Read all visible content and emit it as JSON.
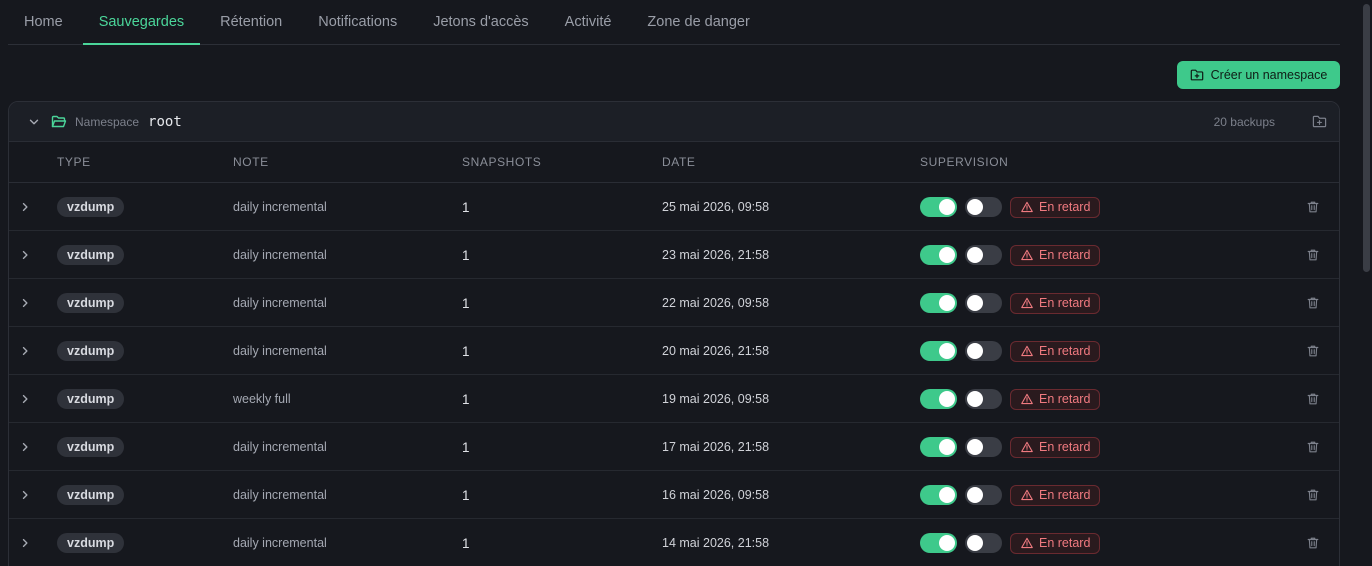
{
  "tabs": [
    {
      "label": "Home",
      "active": false
    },
    {
      "label": "Sauvegardes",
      "active": true
    },
    {
      "label": "Rétention",
      "active": false
    },
    {
      "label": "Notifications",
      "active": false
    },
    {
      "label": "Jetons d'accès",
      "active": false
    },
    {
      "label": "Activité",
      "active": false
    },
    {
      "label": "Zone de danger",
      "active": false
    }
  ],
  "create_button": {
    "label": "Créer un namespace",
    "icon": "folder-plus-icon"
  },
  "namespace": {
    "label": "Namespace",
    "name": "root",
    "count": "20 backups"
  },
  "columns": {
    "type": "TYPE",
    "note": "NOTE",
    "snapshots": "SNAPSHOTS",
    "date": "DATE",
    "supervision": "SUPERVISION"
  },
  "status_label": "En retard",
  "colors": {
    "accent": "#3ec98b",
    "danger": "#f07a80",
    "background": "#16181e"
  },
  "rows": [
    {
      "type": "vzdump",
      "note": "daily incremental",
      "snapshots": "1",
      "date": "25 mai 2026, 09:58",
      "toggle1": true,
      "toggle2": false,
      "status": "En retard"
    },
    {
      "type": "vzdump",
      "note": "daily incremental",
      "snapshots": "1",
      "date": "23 mai 2026, 21:58",
      "toggle1": true,
      "toggle2": false,
      "status": "En retard"
    },
    {
      "type": "vzdump",
      "note": "daily incremental",
      "snapshots": "1",
      "date": "22 mai 2026, 09:58",
      "toggle1": true,
      "toggle2": false,
      "status": "En retard"
    },
    {
      "type": "vzdump",
      "note": "daily incremental",
      "snapshots": "1",
      "date": "20 mai 2026, 21:58",
      "toggle1": true,
      "toggle2": false,
      "status": "En retard"
    },
    {
      "type": "vzdump",
      "note": "weekly full",
      "snapshots": "1",
      "date": "19 mai 2026, 09:58",
      "toggle1": true,
      "toggle2": false,
      "status": "En retard"
    },
    {
      "type": "vzdump",
      "note": "daily incremental",
      "snapshots": "1",
      "date": "17 mai 2026, 21:58",
      "toggle1": true,
      "toggle2": false,
      "status": "En retard"
    },
    {
      "type": "vzdump",
      "note": "daily incremental",
      "snapshots": "1",
      "date": "16 mai 2026, 09:58",
      "toggle1": true,
      "toggle2": false,
      "status": "En retard"
    },
    {
      "type": "vzdump",
      "note": "daily incremental",
      "snapshots": "1",
      "date": "14 mai 2026, 21:58",
      "toggle1": true,
      "toggle2": false,
      "status": "En retard"
    }
  ]
}
